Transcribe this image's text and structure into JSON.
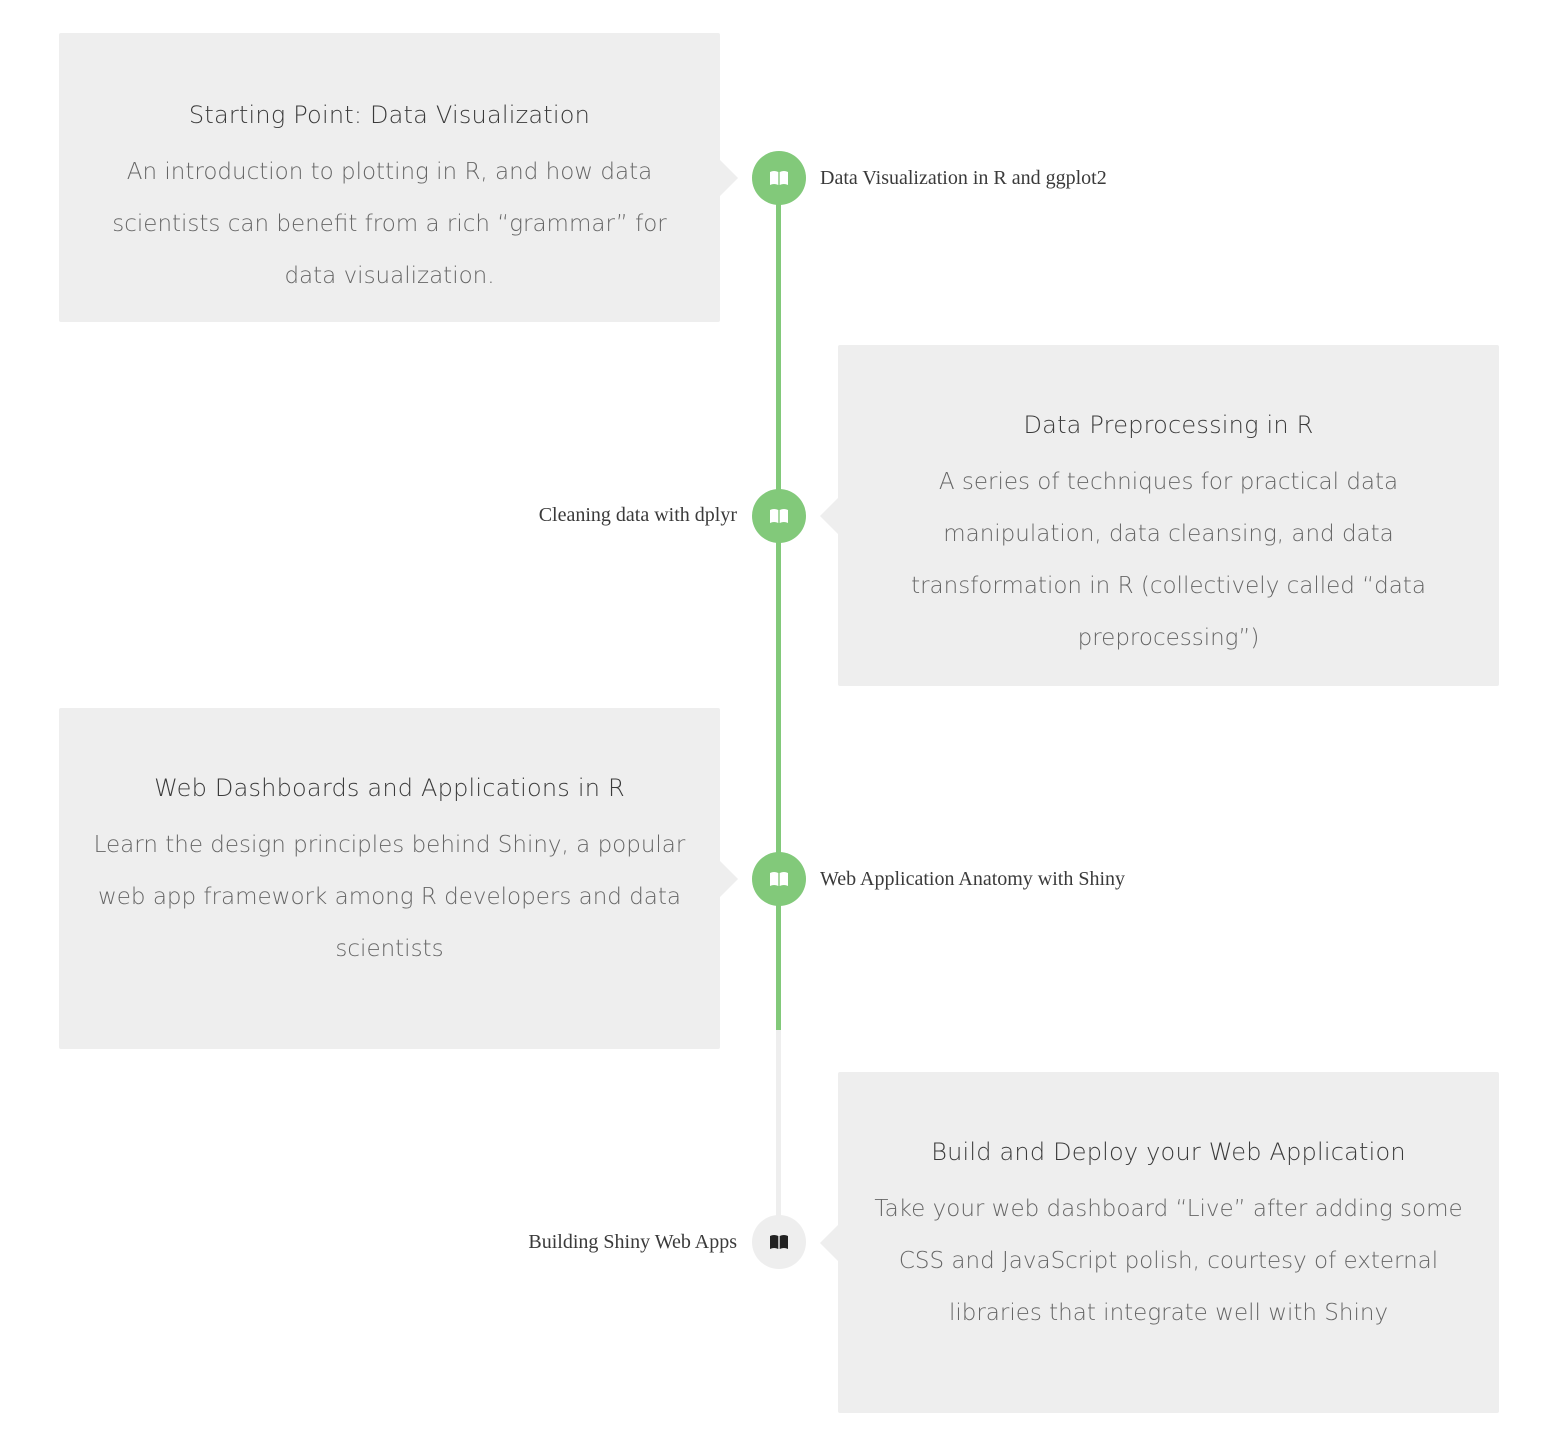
{
  "colors": {
    "completed": "#82c97a",
    "pending": "#eeeeee",
    "card_bg": "#eeeeee"
  },
  "timeline": {
    "items": [
      {
        "label": "Data Visualization in R and ggplot2",
        "title": "Starting Point: Data Visualization",
        "description": "An introduction to plotting in R, and how data scientists can benefit from a rich “grammar” for data visualization.",
        "icon": "book-open-icon",
        "status": "completed"
      },
      {
        "label": "Cleaning data with dplyr",
        "title": "Data Preprocessing in R",
        "description": "A series of techniques for practical data manipulation, data cleansing, and data transformation in R (collectively called “data preprocessing”)",
        "icon": "book-open-icon",
        "status": "completed"
      },
      {
        "label": "Web Application Anatomy with Shiny",
        "title": "Web Dashboards and Applications in R",
        "description": "Learn the design principles behind Shiny, a popular web app framework among R developers and data scientists",
        "icon": "book-open-icon",
        "status": "completed"
      },
      {
        "label": "Building Shiny Web Apps",
        "title": "Build and Deploy your Web Application",
        "description": "Take your web dashboard “Live” after adding some CSS and JavaScript polish, courtesy of external libraries that integrate well with Shiny",
        "icon": "book-open-icon",
        "status": "pending"
      }
    ]
  }
}
